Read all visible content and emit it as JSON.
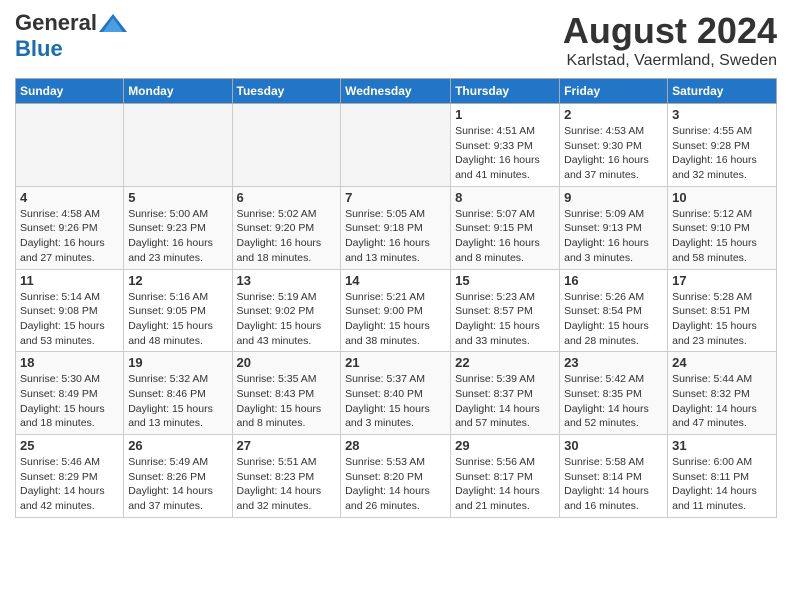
{
  "header": {
    "logo_general": "General",
    "logo_blue": "Blue",
    "month_year": "August 2024",
    "location": "Karlstad, Vaermland, Sweden"
  },
  "days_of_week": [
    "Sunday",
    "Monday",
    "Tuesday",
    "Wednesday",
    "Thursday",
    "Friday",
    "Saturday"
  ],
  "weeks": [
    [
      {
        "day": "",
        "info": ""
      },
      {
        "day": "",
        "info": ""
      },
      {
        "day": "",
        "info": ""
      },
      {
        "day": "",
        "info": ""
      },
      {
        "day": "1",
        "info": "Sunrise: 4:51 AM\nSunset: 9:33 PM\nDaylight: 16 hours and 41 minutes."
      },
      {
        "day": "2",
        "info": "Sunrise: 4:53 AM\nSunset: 9:30 PM\nDaylight: 16 hours and 37 minutes."
      },
      {
        "day": "3",
        "info": "Sunrise: 4:55 AM\nSunset: 9:28 PM\nDaylight: 16 hours and 32 minutes."
      }
    ],
    [
      {
        "day": "4",
        "info": "Sunrise: 4:58 AM\nSunset: 9:26 PM\nDaylight: 16 hours and 27 minutes."
      },
      {
        "day": "5",
        "info": "Sunrise: 5:00 AM\nSunset: 9:23 PM\nDaylight: 16 hours and 23 minutes."
      },
      {
        "day": "6",
        "info": "Sunrise: 5:02 AM\nSunset: 9:20 PM\nDaylight: 16 hours and 18 minutes."
      },
      {
        "day": "7",
        "info": "Sunrise: 5:05 AM\nSunset: 9:18 PM\nDaylight: 16 hours and 13 minutes."
      },
      {
        "day": "8",
        "info": "Sunrise: 5:07 AM\nSunset: 9:15 PM\nDaylight: 16 hours and 8 minutes."
      },
      {
        "day": "9",
        "info": "Sunrise: 5:09 AM\nSunset: 9:13 PM\nDaylight: 16 hours and 3 minutes."
      },
      {
        "day": "10",
        "info": "Sunrise: 5:12 AM\nSunset: 9:10 PM\nDaylight: 15 hours and 58 minutes."
      }
    ],
    [
      {
        "day": "11",
        "info": "Sunrise: 5:14 AM\nSunset: 9:08 PM\nDaylight: 15 hours and 53 minutes."
      },
      {
        "day": "12",
        "info": "Sunrise: 5:16 AM\nSunset: 9:05 PM\nDaylight: 15 hours and 48 minutes."
      },
      {
        "day": "13",
        "info": "Sunrise: 5:19 AM\nSunset: 9:02 PM\nDaylight: 15 hours and 43 minutes."
      },
      {
        "day": "14",
        "info": "Sunrise: 5:21 AM\nSunset: 9:00 PM\nDaylight: 15 hours and 38 minutes."
      },
      {
        "day": "15",
        "info": "Sunrise: 5:23 AM\nSunset: 8:57 PM\nDaylight: 15 hours and 33 minutes."
      },
      {
        "day": "16",
        "info": "Sunrise: 5:26 AM\nSunset: 8:54 PM\nDaylight: 15 hours and 28 minutes."
      },
      {
        "day": "17",
        "info": "Sunrise: 5:28 AM\nSunset: 8:51 PM\nDaylight: 15 hours and 23 minutes."
      }
    ],
    [
      {
        "day": "18",
        "info": "Sunrise: 5:30 AM\nSunset: 8:49 PM\nDaylight: 15 hours and 18 minutes."
      },
      {
        "day": "19",
        "info": "Sunrise: 5:32 AM\nSunset: 8:46 PM\nDaylight: 15 hours and 13 minutes."
      },
      {
        "day": "20",
        "info": "Sunrise: 5:35 AM\nSunset: 8:43 PM\nDaylight: 15 hours and 8 minutes."
      },
      {
        "day": "21",
        "info": "Sunrise: 5:37 AM\nSunset: 8:40 PM\nDaylight: 15 hours and 3 minutes."
      },
      {
        "day": "22",
        "info": "Sunrise: 5:39 AM\nSunset: 8:37 PM\nDaylight: 14 hours and 57 minutes."
      },
      {
        "day": "23",
        "info": "Sunrise: 5:42 AM\nSunset: 8:35 PM\nDaylight: 14 hours and 52 minutes."
      },
      {
        "day": "24",
        "info": "Sunrise: 5:44 AM\nSunset: 8:32 PM\nDaylight: 14 hours and 47 minutes."
      }
    ],
    [
      {
        "day": "25",
        "info": "Sunrise: 5:46 AM\nSunset: 8:29 PM\nDaylight: 14 hours and 42 minutes."
      },
      {
        "day": "26",
        "info": "Sunrise: 5:49 AM\nSunset: 8:26 PM\nDaylight: 14 hours and 37 minutes."
      },
      {
        "day": "27",
        "info": "Sunrise: 5:51 AM\nSunset: 8:23 PM\nDaylight: 14 hours and 32 minutes."
      },
      {
        "day": "28",
        "info": "Sunrise: 5:53 AM\nSunset: 8:20 PM\nDaylight: 14 hours and 26 minutes."
      },
      {
        "day": "29",
        "info": "Sunrise: 5:56 AM\nSunset: 8:17 PM\nDaylight: 14 hours and 21 minutes."
      },
      {
        "day": "30",
        "info": "Sunrise: 5:58 AM\nSunset: 8:14 PM\nDaylight: 14 hours and 16 minutes."
      },
      {
        "day": "31",
        "info": "Sunrise: 6:00 AM\nSunset: 8:11 PM\nDaylight: 14 hours and 11 minutes."
      }
    ]
  ]
}
